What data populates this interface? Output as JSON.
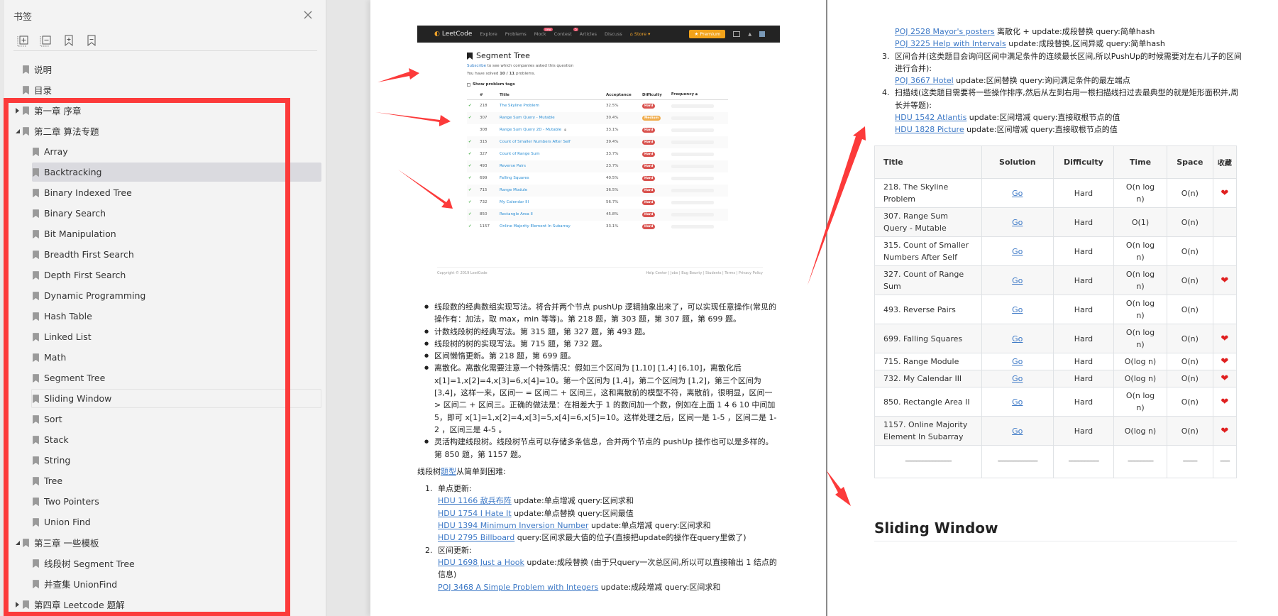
{
  "sidebar": {
    "title": "书签",
    "toolbar": [
      "expand-all",
      "collapse-all",
      "add-bookmark",
      "remove-bookmark"
    ],
    "items": [
      {
        "label": "说明",
        "level": 0,
        "toggle": "none"
      },
      {
        "label": "目录",
        "level": 0,
        "toggle": "none"
      },
      {
        "label": "第一章 序章",
        "level": 0,
        "toggle": "collapsed"
      },
      {
        "label": "第二章 算法专题",
        "level": 0,
        "toggle": "expanded"
      },
      {
        "label": "Array",
        "level": 1
      },
      {
        "label": "Backtracking",
        "level": 1,
        "state": "selected"
      },
      {
        "label": "Binary Indexed Tree",
        "level": 1
      },
      {
        "label": "Binary Search",
        "level": 1
      },
      {
        "label": "Bit Manipulation",
        "level": 1
      },
      {
        "label": "Breadth First Search",
        "level": 1
      },
      {
        "label": "Depth First Search",
        "level": 1
      },
      {
        "label": "Dynamic Programming",
        "level": 1
      },
      {
        "label": "Hash Table",
        "level": 1
      },
      {
        "label": "Linked List",
        "level": 1
      },
      {
        "label": "Math",
        "level": 1
      },
      {
        "label": "Segment Tree",
        "level": 1
      },
      {
        "label": "Sliding Window",
        "level": 1,
        "state": "hover"
      },
      {
        "label": "Sort",
        "level": 1
      },
      {
        "label": "Stack",
        "level": 1
      },
      {
        "label": "String",
        "level": 1
      },
      {
        "label": "Tree",
        "level": 1
      },
      {
        "label": "Two Pointers",
        "level": 1
      },
      {
        "label": "Union Find",
        "level": 1
      },
      {
        "label": "第三章 一些模板",
        "level": 0,
        "toggle": "expanded"
      },
      {
        "label": "线段树 Segment Tree",
        "level": 1
      },
      {
        "label": "并查集 UnionFind",
        "level": 1
      },
      {
        "label": "第四章 Leetcode 题解",
        "level": 0,
        "toggle": "collapsed"
      }
    ]
  },
  "leetcode": {
    "nav": {
      "logo": "LeetCode",
      "links": [
        "Explore",
        "Problems",
        "Mock",
        "Contest",
        "Articles",
        "Discuss"
      ],
      "mock_badge": "new",
      "contest_badge": "5",
      "store": "Store",
      "premium": "Premium"
    },
    "title": "Segment Tree",
    "subscribe_link": "Subscribe",
    "subscribe_text": " to see which companies asked this question",
    "solved_prefix": "You have solved ",
    "solved_count": "10 / 11",
    "solved_suffix": " problems.",
    "show_tags": "Show problem tags",
    "columns": [
      "#",
      "Title",
      "Acceptance",
      "Difficulty",
      "Frequency"
    ],
    "rows": [
      {
        "solved": true,
        "id": "218",
        "title": "The Skyline Problem",
        "acceptance": "32.5%",
        "difficulty": "Hard"
      },
      {
        "solved": true,
        "id": "307",
        "title": "Range Sum Query - Mutable",
        "acceptance": "30.4%",
        "difficulty": "Medium"
      },
      {
        "solved": false,
        "id": "308",
        "title": "Range Sum Query 2D - Mutable",
        "locked": true,
        "acceptance": "33.1%",
        "difficulty": "Hard"
      },
      {
        "solved": true,
        "id": "315",
        "title": "Count of Smaller Numbers After Self",
        "acceptance": "39.4%",
        "difficulty": "Hard"
      },
      {
        "solved": true,
        "id": "327",
        "title": "Count of Range Sum",
        "acceptance": "33.7%",
        "difficulty": "Hard"
      },
      {
        "solved": true,
        "id": "493",
        "title": "Reverse Pairs",
        "acceptance": "23.7%",
        "difficulty": "Hard"
      },
      {
        "solved": true,
        "id": "699",
        "title": "Falling Squares",
        "acceptance": "40.5%",
        "difficulty": "Hard"
      },
      {
        "solved": true,
        "id": "715",
        "title": "Range Module",
        "acceptance": "36.5%",
        "difficulty": "Hard"
      },
      {
        "solved": true,
        "id": "732",
        "title": "My Calendar III",
        "acceptance": "56.7%",
        "difficulty": "Hard"
      },
      {
        "solved": true,
        "id": "850",
        "title": "Rectangle Area II",
        "acceptance": "45.8%",
        "difficulty": "Hard"
      },
      {
        "solved": true,
        "id": "1157",
        "title": "Online Majority Element In Subarray",
        "acceptance": "33.1%",
        "difficulty": "Hard"
      }
    ],
    "copyright": "Copyright © 2019 LeetCode",
    "footer_links": "Help Center | Jobs | Bug Bounty | Students | Terms | Privacy Policy",
    "colors": {
      "hard": "#d9534f",
      "medium": "#f0ad4e"
    }
  },
  "middle": {
    "bullets": [
      "线段数的经典数组实现写法。将合并两个节点 pushUp 逻辑抽象出来了，可以实现任意操作(常见的操作有：加法，取 max，min 等等)。第 218 题，第 303 题，第 307 题，第 699 题。",
      "计数线段树的经典写法。第 315 题，第 327 题，第 493 题。",
      "线段树的树的实现写法。第 715 题，第 732 题。",
      "区间懒惰更新。第 218 题，第 699 题。",
      "离散化。离散化需要注意一个特殊情况：假如三个区间为 [1,10] [1,4] [6,10]，离散化后 x[1]=1,x[2]=4,x[3]=6,x[4]=10。第一个区间为 [1,4]，第二个区间为 [1,2]，第三个区间为 [3,4]，这样一来，区间一 = 区间二 + 区间三，这和离散前的模型不符，离散前，很明显，区间一 > 区间二 + 区间三。正确的做法是：在相差大于 1 的数间加一个数，例如在上面 1 4 6 10 中间加 5，即可 x[1]=1,x[2]=4,x[3]=5,x[4]=6,x[5]=10。这样处理之后，区间一是 1-5 ，区间二是 1-2 ，区间三是 4-5 。",
      "灵活构建线段树。线段树节点可以存储多条信息，合并两个节点的 pushUp 操作也可以是多样的。第 850 题，第 1157 题。"
    ],
    "intro_prefix": "线段树",
    "intro_link": "题型",
    "intro_suffix": "从简单到困难:",
    "sections": [
      {
        "num": "1.",
        "heading": "单点更新:",
        "entries": [
          {
            "link": "HDU 1166 敌兵布阵",
            "text": " update:单点增减 query:区间求和"
          },
          {
            "link": "HDU 1754 I Hate It",
            "text": " update:单点替换 query:区间最值"
          },
          {
            "link": "HDU 1394 Minimum Inversion Number",
            "text": " update:单点增减 query:区间求和"
          },
          {
            "link": "HDU 2795 Billboard",
            "text": " query:区间求最大值的位子(直接把update的操作在query里做了)"
          }
        ]
      },
      {
        "num": "2.",
        "heading": "区间更新:",
        "entries": [
          {
            "link": "HDU 1698 Just a Hook",
            "text": " update:成段替换 (由于只query一次总区间,所以可以直接输出 1 结点的信息)"
          },
          {
            "link": "POJ 3468 A Simple Problem with Integers",
            "text": " update:成段增减 query:区间求和"
          }
        ]
      }
    ]
  },
  "right": {
    "cont_entries": [
      {
        "link": "POJ 2528 Mayor's posters",
        "text": " 离散化 + update:成段替换 query:简单hash"
      },
      {
        "link": "POJ 3225 Help with Intervals",
        "text": " update:成段替换,区间异或 query:简单hash"
      }
    ],
    "sections": [
      {
        "num": "3.",
        "heading": "区间合并(这类题目会询问区间中满足条件的连续最长区间,所以PushUp的时候需要对左右儿子的区间进行合并):",
        "entries": [
          {
            "link": "POJ 3667 Hotel",
            "text": " update:区间替换 query:询问满足条件的最左端点"
          }
        ]
      },
      {
        "num": "4.",
        "heading": "扫描线(这类题目需要将一些操作排序,然后从左到右用一根扫描线扫过去最典型的就是矩形面积并,周长并等题):",
        "entries": [
          {
            "link": "HDU 1542 Atlantis",
            "text": " update:区间增减 query:直接取根节点的值"
          },
          {
            "link": "HDU 1828 Picture",
            "text": " update:区间增减 query:直接取根节点的值"
          }
        ]
      }
    ],
    "table": {
      "columns": [
        "Title",
        "Solution",
        "Difficulty",
        "Time",
        "Space",
        "收藏"
      ],
      "rows": [
        {
          "title": "218. The Skyline Problem",
          "solution": "Go",
          "difficulty": "Hard",
          "time": "O(n log n)",
          "space": "O(n)",
          "fav": true
        },
        {
          "title": "307. Range Sum Query - Mutable",
          "solution": "Go",
          "difficulty": "Hard",
          "time": "O(1)",
          "space": "O(n)",
          "fav": false
        },
        {
          "title": "315. Count of Smaller Numbers After Self",
          "solution": "Go",
          "difficulty": "Hard",
          "time": "O(n log n)",
          "space": "O(n)",
          "fav": false
        },
        {
          "title": "327. Count of Range Sum",
          "solution": "Go",
          "difficulty": "Hard",
          "time": "O(n log n)",
          "space": "O(n)",
          "fav": true
        },
        {
          "title": "493. Reverse Pairs",
          "solution": "Go",
          "difficulty": "Hard",
          "time": "O(n log n)",
          "space": "O(n)",
          "fav": false
        },
        {
          "title": "699. Falling Squares",
          "solution": "Go",
          "difficulty": "Hard",
          "time": "O(n log n)",
          "space": "O(n)",
          "fav": true
        },
        {
          "title": "715. Range Module",
          "solution": "Go",
          "difficulty": "Hard",
          "time": "O(log n)",
          "space": "O(n)",
          "fav": true
        },
        {
          "title": "732. My Calendar III",
          "solution": "Go",
          "difficulty": "Hard",
          "time": "O(log n)",
          "space": "O(n)",
          "fav": true
        },
        {
          "title": "850. Rectangle Area II",
          "solution": "Go",
          "difficulty": "Hard",
          "time": "O(n log n)",
          "space": "O(n)",
          "fav": true
        },
        {
          "title": "1157. Online Majority Element In Subarray",
          "solution": "Go",
          "difficulty": "Hard",
          "time": "O(log n)",
          "space": "O(n)",
          "fav": true
        }
      ],
      "separator_row": [
        "-----------------------------",
        "-------------------------",
        "-------------------",
        "----------------",
        "---------",
        "------"
      ],
      "heart": "❤"
    },
    "next_heading": "Sliding Window"
  },
  "colors": {
    "annotation_red": "#fc3a3a",
    "link_blue": "#3c78c6",
    "heart_red": "#e02020"
  }
}
